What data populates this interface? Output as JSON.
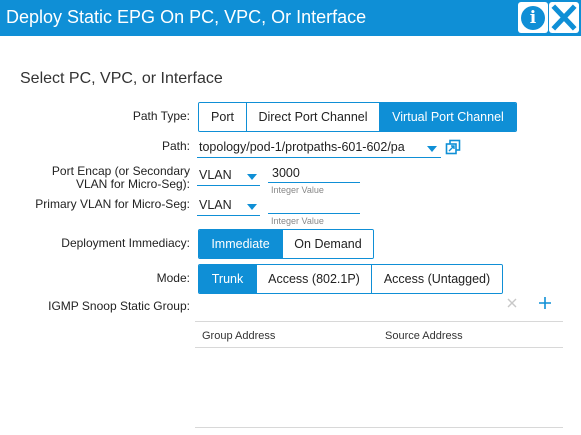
{
  "header": {
    "title": "Deploy Static EPG On PC, VPC, Or Interface"
  },
  "section": {
    "heading": "Select PC, VPC, or Interface"
  },
  "path_type": {
    "label": "Path Type:",
    "options": [
      "Port",
      "Direct Port Channel",
      "Virtual Port Channel"
    ],
    "selected": "Virtual Port Channel"
  },
  "path": {
    "label": "Path:",
    "value": "topology/pod-1/protpaths-601-602/pa"
  },
  "port_encap": {
    "label_line1": "Port Encap (or Secondary",
    "label_line2": "VLAN for Micro-Seg):",
    "type": "VLAN",
    "value": "3000",
    "hint": "Integer Value"
  },
  "primary_vlan": {
    "label": "Primary VLAN for Micro-Seg:",
    "type": "VLAN",
    "value": "",
    "hint": "Integer Value"
  },
  "deployment_immediacy": {
    "label": "Deployment Immediacy:",
    "options": [
      "Immediate",
      "On Demand"
    ],
    "selected": "Immediate"
  },
  "mode": {
    "label": "Mode:",
    "options": [
      "Trunk",
      "Access (802.1P)",
      "Access (Untagged)"
    ],
    "selected": "Trunk"
  },
  "igmp": {
    "label": "IGMP Snoop Static Group:",
    "columns": [
      "Group Address",
      "Source Address"
    ],
    "rows": []
  },
  "colors": {
    "accent": "#0f8fd6"
  }
}
